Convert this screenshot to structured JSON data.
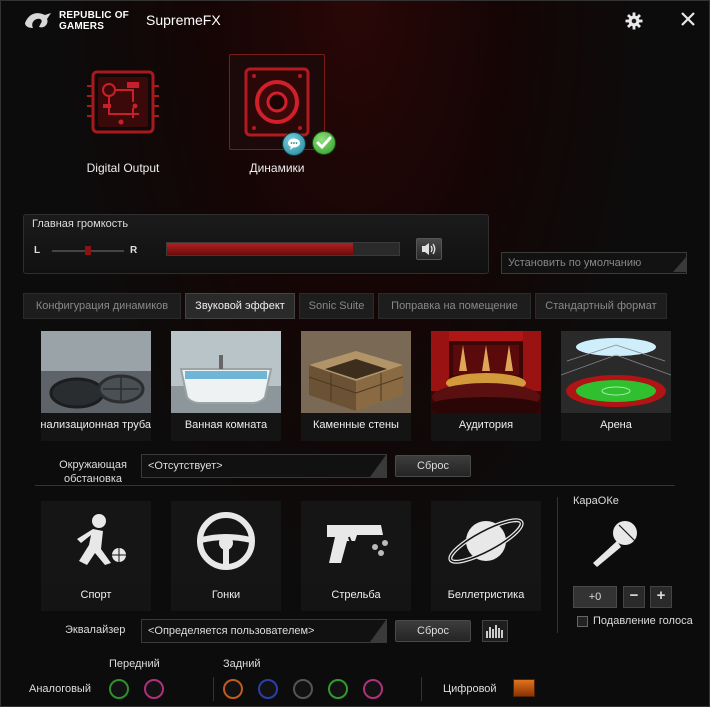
{
  "window": {
    "brand_line1": "REPUBLIC OF",
    "brand_line2": "GAMERS",
    "title": "SupremeFX",
    "icons": [
      "rog-logo-icon",
      "gear-icon",
      "close-icon"
    ]
  },
  "devices": [
    {
      "label": "Digital Output",
      "icon": "digital-output-icon",
      "selected": false
    },
    {
      "label": "Динамики",
      "icon": "speaker-icon",
      "selected": true
    }
  ],
  "master_volume": {
    "title": "Главная громкость",
    "left_label": "L",
    "right_label": "R",
    "balance_percent": 50,
    "volume_percent": 80
  },
  "default_button": "Установить по умолчанию",
  "tabs": [
    {
      "label": "Конфигурация динамиков",
      "active": false
    },
    {
      "label": "Звуковой эффект",
      "active": true
    },
    {
      "label": "Sonic Suite",
      "active": false
    },
    {
      "label": "Поправка на помещение",
      "active": false
    },
    {
      "label": "Стандартный формат",
      "active": false
    }
  ],
  "environment_tiles": [
    {
      "label": "Канализационная труба",
      "icon": "sewer-pipe-icon"
    },
    {
      "label": "Ванная комната",
      "icon": "bathtub-icon"
    },
    {
      "label": "Каменные стены",
      "icon": "stone-walls-icon"
    },
    {
      "label": "Аудитория",
      "icon": "auditorium-icon"
    },
    {
      "label": "Арена",
      "icon": "arena-icon"
    }
  ],
  "environment": {
    "label_line1": "Окружающая",
    "label_line2": "обстановка",
    "value": "<Отсутствует>",
    "reset": "Сброс"
  },
  "eq_tiles": [
    {
      "label": "Спорт",
      "icon": "basketball-player-icon"
    },
    {
      "label": "Гонки",
      "icon": "steering-wheel-icon"
    },
    {
      "label": "Стрельба",
      "icon": "pistol-icon"
    },
    {
      "label": "Беллетристика",
      "icon": "planet-icon"
    }
  ],
  "equalizer": {
    "label": "Эквалайзер",
    "value": "<Определяется пользователем>",
    "reset": "Сброс"
  },
  "karaoke": {
    "title": "КараОКе",
    "value": "+0",
    "minus": "−",
    "plus": "+",
    "voice_cancel": "Подавление голоса",
    "voice_cancel_checked": false
  },
  "bottom": {
    "analog_label": "Аналоговый",
    "front_label": "Передний",
    "rear_label": "Задний",
    "digital_label": "Цифровой",
    "front_jacks": [
      {
        "color": "#2f8f2f"
      },
      {
        "color": "#b0307a"
      }
    ],
    "rear_jacks": [
      {
        "color": "#c05a20"
      },
      {
        "color": "#2a3fa8"
      },
      {
        "color": "#555555"
      },
      {
        "color": "#2f9a2f"
      },
      {
        "color": "#b0307a"
      }
    ]
  },
  "colors": {
    "accent": "#b32020",
    "background": "#0e0e0e"
  }
}
